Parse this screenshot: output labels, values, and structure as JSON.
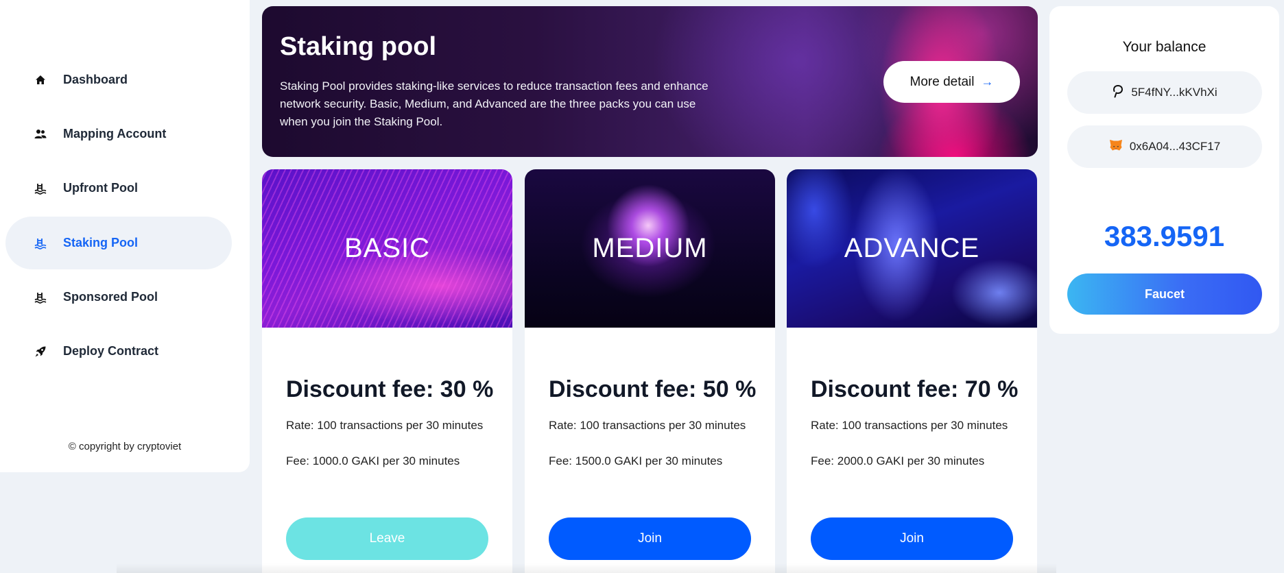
{
  "sidebar": {
    "items": [
      {
        "label": "Dashboard",
        "icon": "home-icon"
      },
      {
        "label": "Mapping Account",
        "icon": "users-icon"
      },
      {
        "label": "Upfront Pool",
        "icon": "pool-icon"
      },
      {
        "label": "Staking Pool",
        "icon": "pool-icon",
        "active": true
      },
      {
        "label": "Sponsored Pool",
        "icon": "pool-icon"
      },
      {
        "label": "Deploy Contract",
        "icon": "rocket-icon"
      }
    ],
    "copyright": "© copyright by cryptoviet"
  },
  "hero": {
    "title": "Staking pool",
    "description": "Staking Pool provides staking-like services to reduce transaction fees and enhance network security. Basic, Medium, and Advanced are the three packs you can use when you join the Staking Pool.",
    "button_label": "More detail",
    "button_arrow": "→"
  },
  "cards": [
    {
      "name": "BASIC",
      "title": "Discount fee: 30 %",
      "rate": "Rate: 100 transactions per 30 minutes",
      "fee": "Fee: 1000.0 GAKI per 30 minutes",
      "button": "Leave"
    },
    {
      "name": "MEDIUM",
      "title": "Discount fee: 50 %",
      "rate": "Rate: 100 transactions per 30 minutes",
      "fee": "Fee: 1500.0 GAKI per 30 minutes",
      "button": "Join"
    },
    {
      "name": "ADVANCE",
      "title": "Discount fee: 70 %",
      "rate": "Rate: 100 transactions per 30 minutes",
      "fee": "Fee: 2000.0 GAKI per 30 minutes",
      "button": "Join"
    }
  ],
  "balance": {
    "title": "Your balance",
    "polkadot_address": "5F4fNY...kKVhXi",
    "metamask_address": "0x6A04...43CF17",
    "amount": "383.9591",
    "faucet_label": "Faucet"
  },
  "colors": {
    "accent": "#1565f5",
    "join_button": "#005bff",
    "leave_button": "#6ce3e3",
    "background": "#eef2f7"
  }
}
